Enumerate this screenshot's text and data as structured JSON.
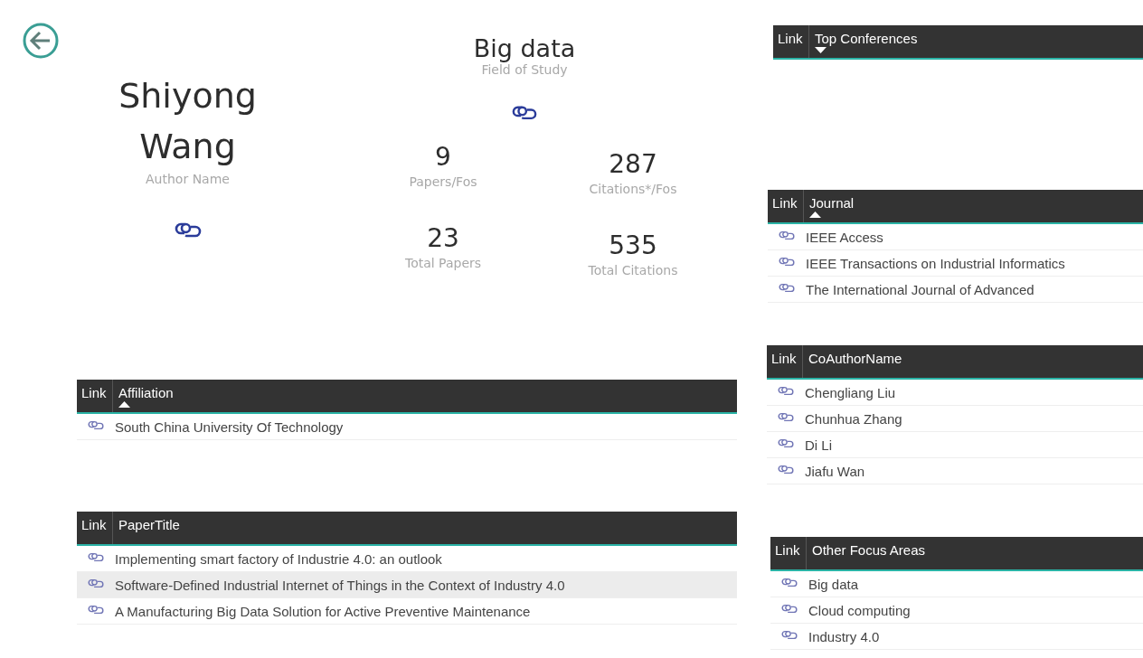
{
  "author": {
    "name": "Shiyong Wang",
    "label": "Author Name"
  },
  "field": {
    "name": "Big data",
    "label": "Field of Study"
  },
  "kpis": [
    {
      "value": "9",
      "label": "Papers/Fos"
    },
    {
      "value": "287",
      "label": "Citations*/Fos"
    },
    {
      "value": "23",
      "label": "Total Papers"
    },
    {
      "value": "535",
      "label": "Total Citations"
    }
  ],
  "left_tables": [
    {
      "link_header": "Link",
      "header": "Affiliation",
      "sorted_ascending": true,
      "rows": [
        {
          "text": "South China University Of Technology",
          "selected": false
        }
      ]
    },
    {
      "link_header": "Link",
      "header": "PaperTitle",
      "rows": [
        {
          "text": "Implementing smart factory of Industrie 4.0: an outlook",
          "selected": false
        },
        {
          "text": "Software-Defined Industrial Internet of Things in the Context of Industry 4.0",
          "selected": true
        },
        {
          "text": "A Manufacturing Big Data Solution for Active Preventive Maintenance",
          "selected": false
        }
      ]
    }
  ],
  "right_tables": [
    {
      "link_header": "Link",
      "header": "Top Conferences",
      "sorted_ascending": false
    },
    {
      "link_header": "Link",
      "header": "Journal",
      "sorted_ascending": true,
      "rows": [
        {
          "text": "IEEE Access",
          "selected": false
        },
        {
          "text": "IEEE Transactions on Industrial Informatics",
          "selected": false
        },
        {
          "text": "The International Journal of Advanced",
          "selected": false
        }
      ]
    },
    {
      "link_header": "Link",
      "header": "CoAuthorName",
      "rows": [
        {
          "text": "Chengliang Liu",
          "selected": false
        },
        {
          "text": "Chunhua Zhang",
          "selected": false
        },
        {
          "text": "Di Li",
          "selected": false
        },
        {
          "text": "Jiafu Wan",
          "selected": false
        }
      ]
    },
    {
      "link_header": "Link",
      "header": "Other Focus Areas",
      "rows": [
        {
          "text": "Big data",
          "selected": false
        },
        {
          "text": "Cloud computing",
          "selected": false
        },
        {
          "text": "Industry 4.0",
          "selected": false
        }
      ]
    }
  ]
}
